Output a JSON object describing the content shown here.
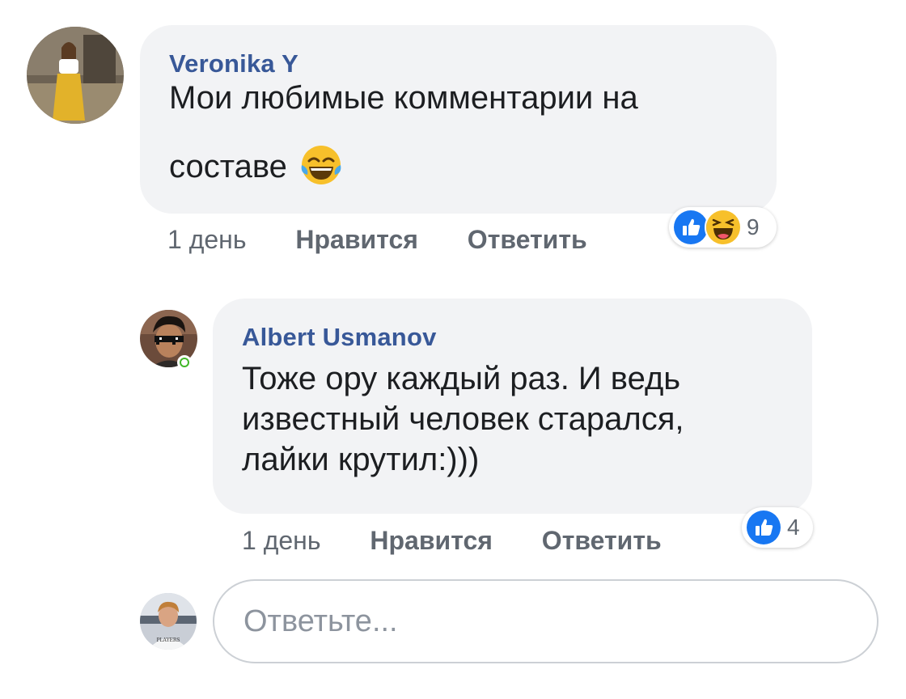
{
  "comments": [
    {
      "author": "Veronika Y",
      "text_line1": "Мои любимые комментарии на",
      "text_line2": "составе",
      "emoji": "face-with-tears-of-joy",
      "time": "1 день",
      "like_label": "Нравится",
      "reply_label": "Ответить",
      "reactions": [
        "like",
        "haha"
      ],
      "reaction_count": "9"
    },
    {
      "author": "Albert Usmanov",
      "text_line1": "Тоже ору каждый раз. И ведь",
      "text_line2": "известный человек старался,",
      "text_line3": "лайки крутил:)))",
      "online": true,
      "time": "1 день",
      "like_label": "Нравится",
      "reply_label": "Ответить",
      "reactions": [
        "like"
      ],
      "reaction_count": "4"
    }
  ],
  "reply": {
    "placeholder": "Ответьте...",
    "value": ""
  },
  "colors": {
    "bubble": "#f2f3f5",
    "author": "#385898",
    "meta": "#606770",
    "like_blue": "#1877f2",
    "online_green": "#42b72a",
    "input_border": "#ccd0d5"
  }
}
